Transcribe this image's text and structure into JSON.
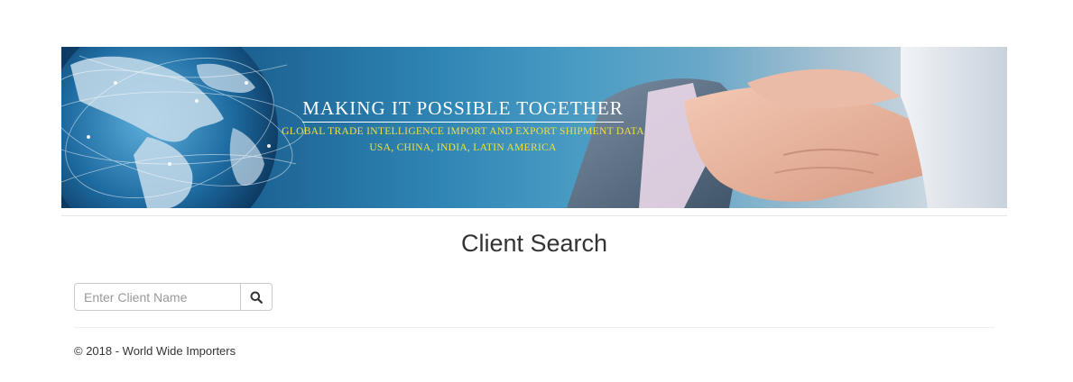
{
  "banner": {
    "headline": "MAKING IT POSSIBLE TOGETHER",
    "subline1": "GLOBAL TRADE INTELLIGENCE IMPORT AND EXPORT SHIPMENT DATA",
    "subline2": "USA, CHINA, INDIA, LATIN AMERICA",
    "headline_color": "#ffffff",
    "subline_color": "#f0e040"
  },
  "page": {
    "title": "Client Search"
  },
  "search": {
    "placeholder": "Enter Client Name",
    "value": "",
    "button_icon": "search-icon"
  },
  "footer": {
    "text": "© 2018 - World Wide Importers"
  }
}
